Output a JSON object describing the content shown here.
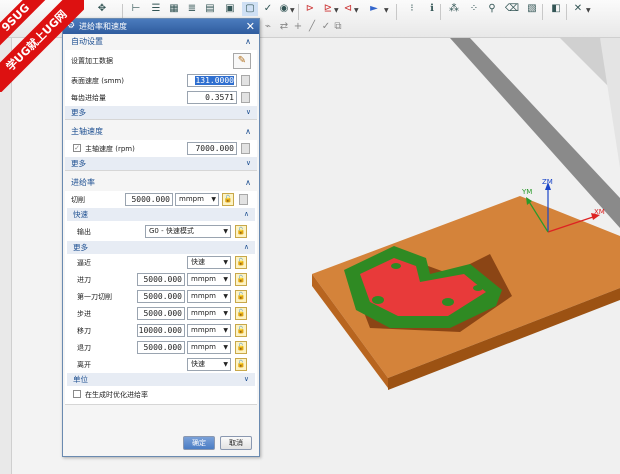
{
  "dialog": {
    "title": "进给率和速度",
    "close_glyph": "✕",
    "auto_settings": {
      "header": "自动设置",
      "set_machining_data_label": "设置加工数据",
      "surface_speed_label": "表面速度 (smm)",
      "surface_speed_value": "131.0000",
      "feed_per_tooth_label": "每齿进给量",
      "feed_per_tooth_value": "0.3571",
      "more_label": "更多"
    },
    "spindle": {
      "header": "主轴速度",
      "spindle_speed_label": "主轴速度 (rpm)",
      "spindle_speed_value": "7000.000",
      "spindle_checked": true,
      "more_label": "更多"
    },
    "feed_rates": {
      "header": "进给率",
      "cut_label": "切削",
      "cut_value": "5000.000",
      "cut_unit": "mmpm",
      "rapid": {
        "header": "快速",
        "output_label": "输出",
        "output_value": "G0 - 快速模式"
      },
      "more": {
        "header": "更多",
        "rows": [
          {
            "label": "逼近",
            "type": "select",
            "value": "快速"
          },
          {
            "label": "进刀",
            "type": "input",
            "value": "5000.000",
            "unit": "mmpm"
          },
          {
            "label": "第一刀切削",
            "type": "input",
            "value": "5000.000",
            "unit": "mmpm"
          },
          {
            "label": "步进",
            "type": "input",
            "value": "5000.000",
            "unit": "mmpm"
          },
          {
            "label": "移刀",
            "type": "input",
            "value": "10000.000",
            "unit": "mmpm"
          },
          {
            "label": "退刀",
            "type": "input",
            "value": "5000.000",
            "unit": "mmpm"
          },
          {
            "label": "离开",
            "type": "select",
            "value": "快速"
          }
        ]
      },
      "units_header": "单位",
      "optimize_label": "在生成时优化进给率",
      "optimize_checked": false
    },
    "ok_label": "确定",
    "cancel_label": "取消"
  },
  "viewport": {
    "axis_x": "XM",
    "axis_y": "YM",
    "axis_z": "ZM",
    "part_color": "#2f8a23",
    "pocket_color": "#e83a3a",
    "fixture_color": "#d07a2c"
  },
  "watermark": {
    "line1": "9SUG",
    "line2": "学UG就上UG网"
  }
}
